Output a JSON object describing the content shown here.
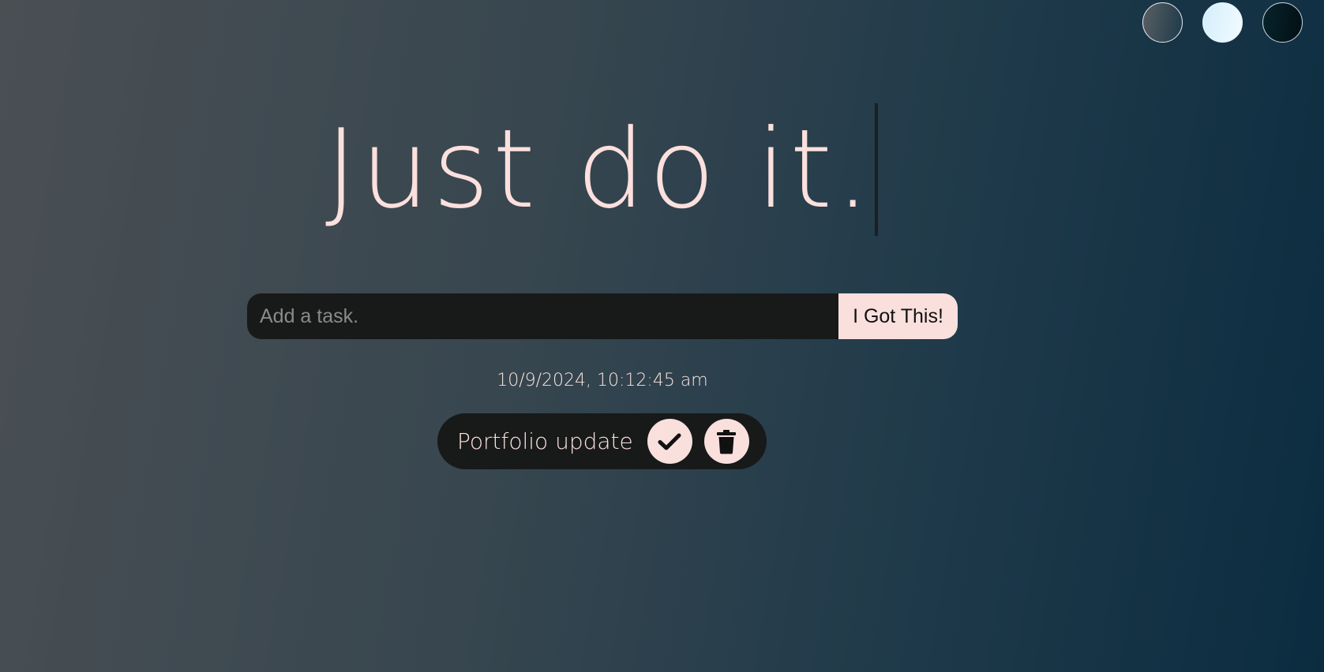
{
  "theme_switcher": {
    "themes": [
      {
        "name": "standard",
        "icon": "theme-standard-icon",
        "color_from": "#5a5f63",
        "color_to": "#1d3a4a"
      },
      {
        "name": "light",
        "icon": "theme-light-icon",
        "color_from": "#d4eefc",
        "color_to": "#f2fbff"
      },
      {
        "name": "darker",
        "icon": "theme-darker-icon",
        "color_from": "#07242c",
        "color_to": "#020f14"
      }
    ]
  },
  "header": {
    "title": "Just do it."
  },
  "task_form": {
    "input_value": "",
    "input_placeholder": "Add a task.",
    "submit_label": "I Got This!"
  },
  "datetime": "10/9/2024, 10:12:45 am",
  "todos": [
    {
      "text": "Portfolio update",
      "check_icon": "check-icon",
      "delete_icon": "trash-icon"
    }
  ],
  "colors": {
    "accent": "#f9e0dd",
    "panel": "#181a1a",
    "text_light": "#fde3df"
  }
}
